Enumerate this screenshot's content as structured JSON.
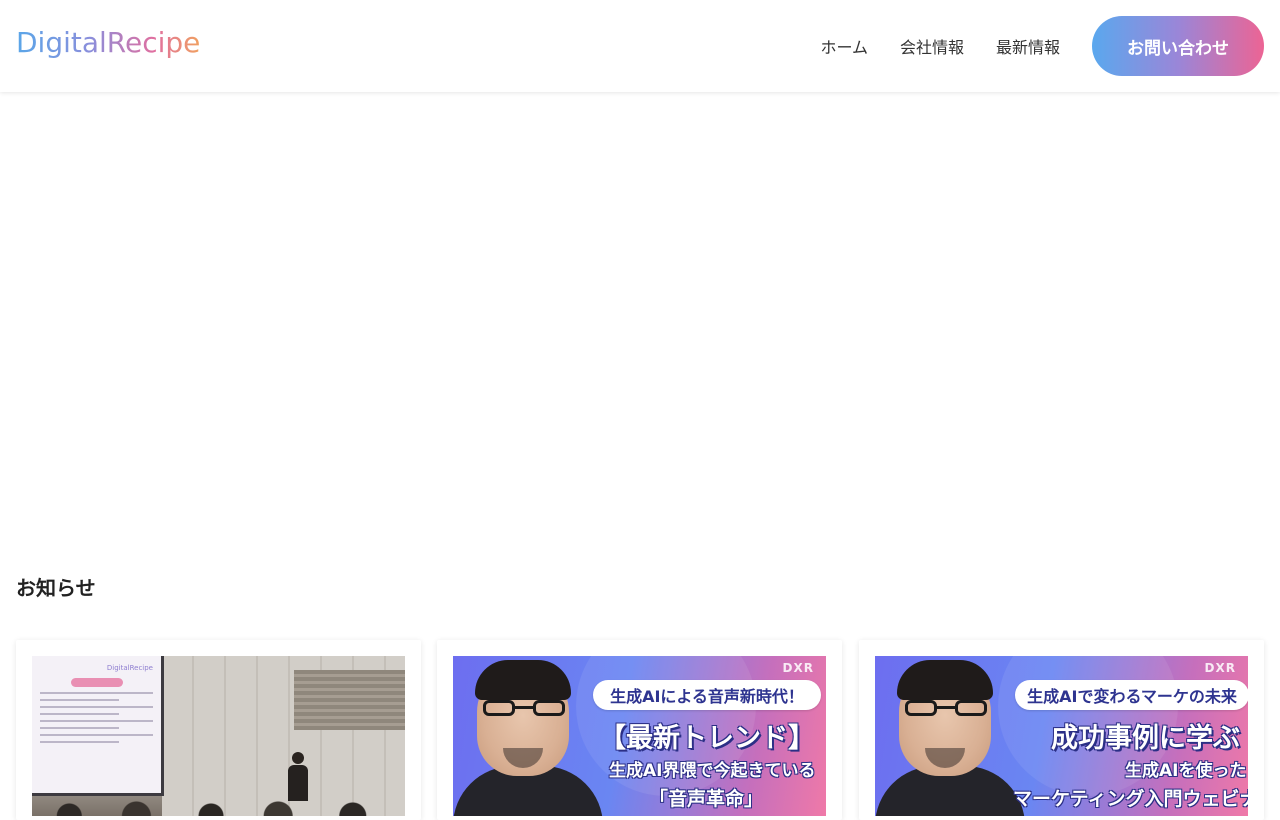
{
  "header": {
    "logo_text": "DigitalRecipe",
    "nav": [
      {
        "label": "ホーム"
      },
      {
        "label": "会社情報"
      },
      {
        "label": "最新情報"
      }
    ],
    "contact_label": "お問い合わせ"
  },
  "news": {
    "title": "お知らせ",
    "cards": [
      {
        "type": "event-photo",
        "screen_brand": "DigitalRecipe"
      },
      {
        "type": "banner",
        "dxr": "DXR",
        "pill": "生成AIによる音声新時代！",
        "headline": "【最新トレンド】",
        "sub": "生成AI界隈で今起きている",
        "sub2": "「音声革命」"
      },
      {
        "type": "banner",
        "dxr": "DXR",
        "pill": "生成AIで変わるマーケの未来",
        "headline": "成功事例に学ぶ",
        "sub": "生成AIを使った",
        "sub2": "マーケティング入門ウェビナー"
      }
    ]
  },
  "colors": {
    "accent_start": "#5aa8ee",
    "accent_end": "#ec6494",
    "banner_text": "#2e3490"
  }
}
